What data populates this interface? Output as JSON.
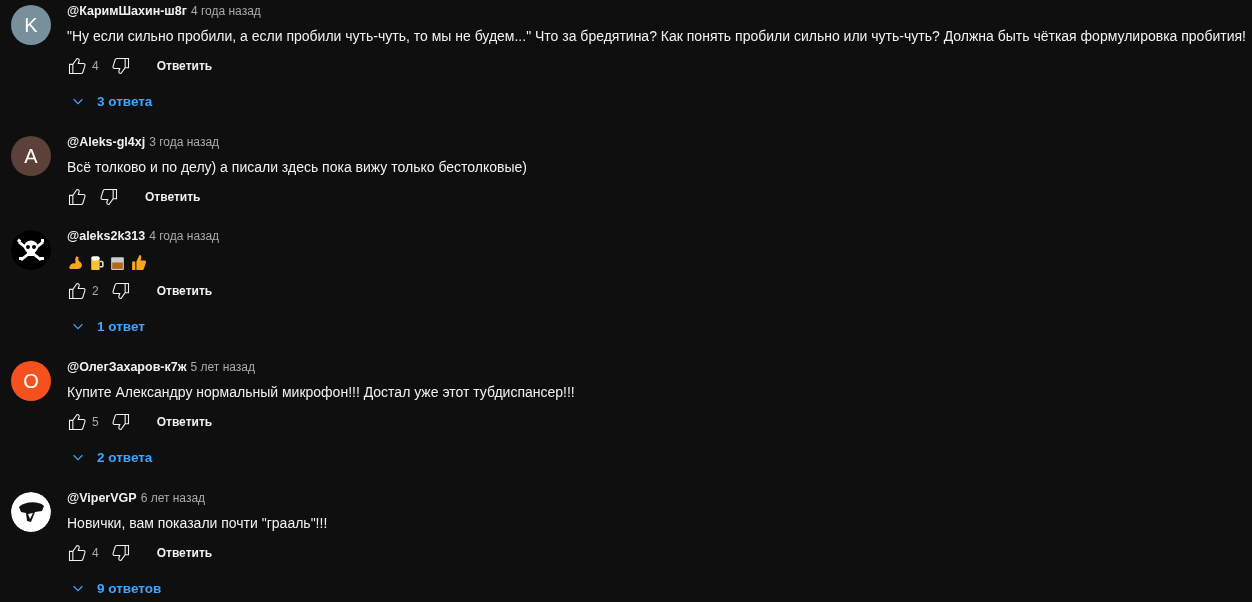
{
  "comments": [
    {
      "avatar": {
        "kind": "letter",
        "letter": "K",
        "color": "#78909c"
      },
      "author": "@КаримШахин-ш8г",
      "time": "4 года назад",
      "text": "\"Ну если сильно пробили, а если пробили чуть-чуть, то мы не будем...\" Что за бредятина? Как понять пробили сильно или чуть-чуть? Должна быть чёткая формулировка пробития!",
      "likes": "4",
      "reply": "Ответить",
      "replies": "3 ответа"
    },
    {
      "avatar": {
        "kind": "letter",
        "letter": "A",
        "color": "#5d4037"
      },
      "author": "@Aleks-gl4xj",
      "time": "3 года назад",
      "text": "Всё толково и по делу) а писали здесь пока вижу только бестолковые)",
      "reply": "Ответить"
    },
    {
      "avatar": {
        "kind": "skull"
      },
      "author": "@aleks2k313",
      "time": "4 года назад",
      "emoji": [
        {
          "kind": "muscle"
        },
        {
          "kind": "beer"
        },
        {
          "kind": "whisky"
        },
        {
          "kind": "thumbs_up"
        }
      ],
      "likes": "2",
      "reply": "Ответить",
      "replies": "1 ответ"
    },
    {
      "avatar": {
        "kind": "letter",
        "letter": "O",
        "color": "#f4511e"
      },
      "author": "@ОлегЗахаров-к7ж",
      "time": "5 лет назад",
      "text": "Купите Александру нормальный микрофон!!! Достал уже этот тубдиспансер!!!",
      "likes": "5",
      "reply": "Ответить",
      "replies": "2 ответа"
    },
    {
      "avatar": {
        "kind": "logo"
      },
      "author": "@ViperVGP",
      "time": "6 лет назад",
      "text": "Новички, вам показали почти \"грааль\"!!!",
      "likes": "4",
      "reply": "Ответить",
      "replies": "9 ответов"
    }
  ]
}
